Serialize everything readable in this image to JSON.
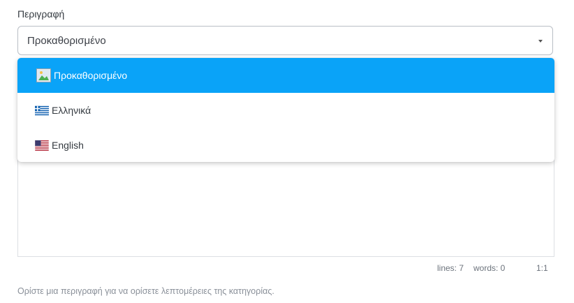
{
  "field": {
    "label": "Περιγραφή",
    "selected_value": "Προκαθορισμένο"
  },
  "dropdown": {
    "options": [
      {
        "label": "Προκαθορισμένο",
        "icon": "broken-image-icon",
        "selected": true
      },
      {
        "label": "Ελληνικά",
        "icon": "greece-flag-icon",
        "selected": false
      },
      {
        "label": "English",
        "icon": "usa-flag-icon",
        "selected": false
      }
    ],
    "selected_color": "#0aa3f8"
  },
  "status": {
    "lines": "lines: 7",
    "words": "words: 0",
    "cursor": "1:1"
  },
  "hint": "Ορίστε μια περιγραφή για να ορίσετε λεπτομέρειες της κατηγορίας."
}
